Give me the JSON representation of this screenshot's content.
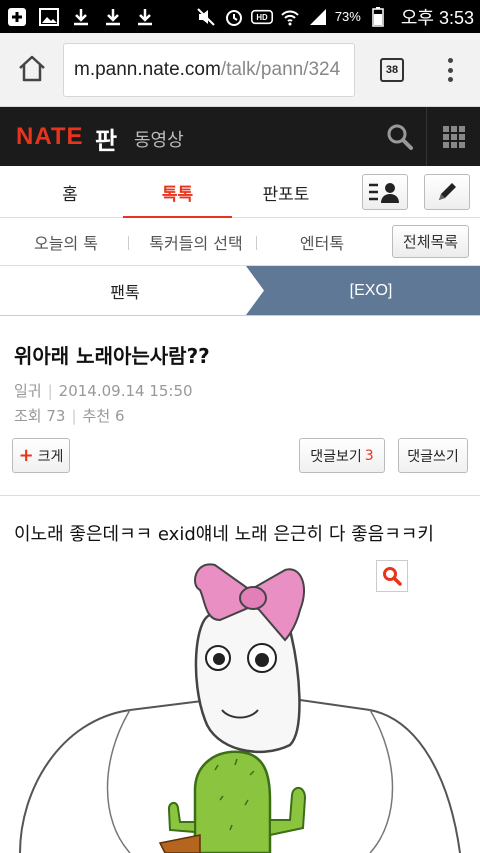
{
  "status_bar": {
    "battery_percent": "73%",
    "time": "오후 3:53",
    "icons": [
      "plus-box-icon",
      "image-icon",
      "download-icon",
      "download-icon",
      "download-icon",
      "mute-icon",
      "alarm-icon",
      "hd-icon",
      "wifi-icon",
      "signal-icon",
      "battery-icon"
    ]
  },
  "browser": {
    "url_host": "m.pann.nate.com",
    "url_path": "/talk/pann/324",
    "tab_count": "38"
  },
  "header": {
    "logo": "NATE",
    "service": "판",
    "video_link": "동영상"
  },
  "main_tabs": [
    {
      "label": "홈",
      "active": false
    },
    {
      "label": "톡톡",
      "active": true
    },
    {
      "label": "판포토",
      "active": false
    }
  ],
  "sub_tabs": [
    {
      "label": "오늘의 톡"
    },
    {
      "label": "톡커들의 선택"
    },
    {
      "label": "엔터톡"
    }
  ],
  "sub_tabs_button": "전체목록",
  "breadcrumb": {
    "left": "팬톡",
    "right": "[EXO]"
  },
  "post": {
    "title": "위아래 노래아는사람??",
    "author": "일귀",
    "date": "2014.09.14 15:50",
    "views_label": "조회",
    "views": "73",
    "recommend_label": "추천",
    "recommend": "6",
    "enlarge_label": "크게",
    "comments_view_label": "댓글보기",
    "comments_count": "3",
    "comment_write_label": "댓글쓰기",
    "body": "이노래 좋은데ㅋㅋ exid얘네 노래 은근히 다 좋음ㅋㅋ키"
  },
  "colors": {
    "accent": "#e8341c",
    "header_bg": "#1b1b1b",
    "crumb_active": "#5f7896"
  }
}
